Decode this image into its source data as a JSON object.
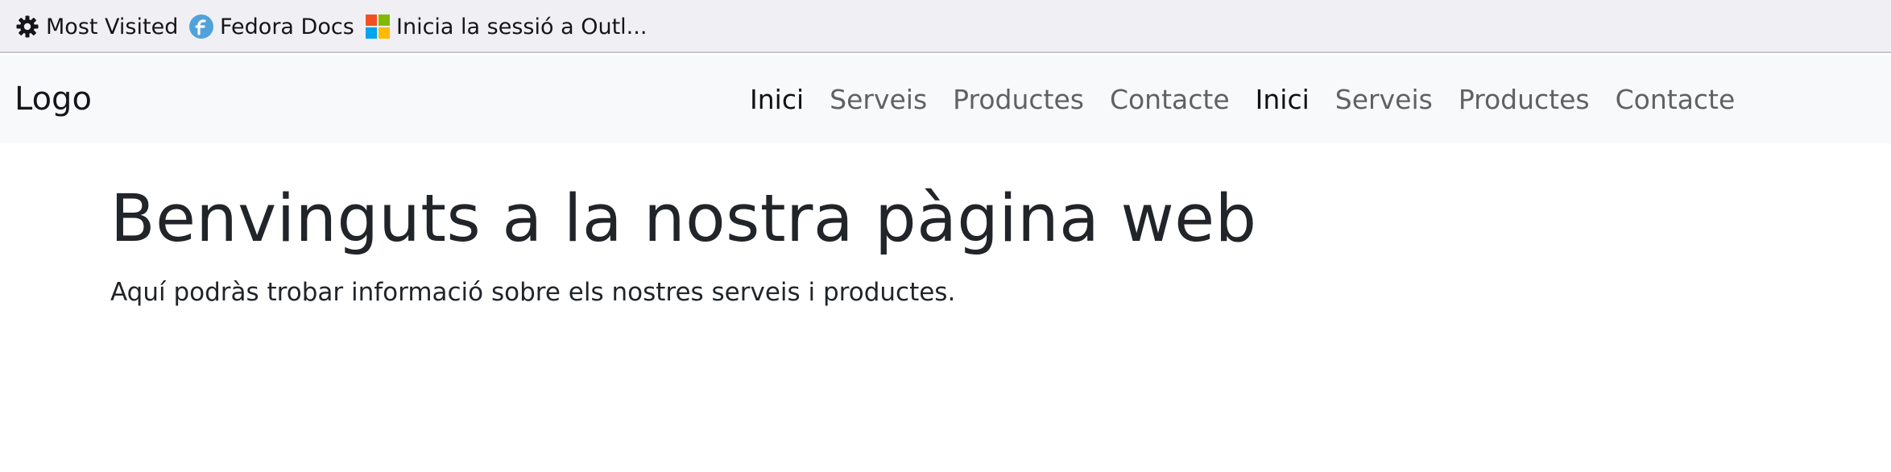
{
  "bookmarks": [
    {
      "label": "Most Visited",
      "icon": "gear-icon"
    },
    {
      "label": "Fedora Docs",
      "icon": "fedora-icon"
    },
    {
      "label": "Inicia la sessió a Outl...",
      "icon": "microsoft-icon"
    }
  ],
  "navbar": {
    "brand": "Logo",
    "links": [
      {
        "label": "Inici",
        "active": true
      },
      {
        "label": "Serveis",
        "active": false
      },
      {
        "label": "Productes",
        "active": false
      },
      {
        "label": "Contacte",
        "active": false
      },
      {
        "label": "Inici",
        "active": true
      },
      {
        "label": "Serveis",
        "active": false
      },
      {
        "label": "Productes",
        "active": false
      },
      {
        "label": "Contacte",
        "active": false
      }
    ]
  },
  "main": {
    "title": "Benvinguts a la nostra pàgina web",
    "text": "Aquí podràs trobar informació sobre els nostres serveis i productes."
  },
  "colors": {
    "toolbar_bg": "#f0f0f4",
    "navbar_bg": "#f8f9fa",
    "text_dark": "#212529",
    "nav_muted": "#616161",
    "fedora_blue": "#51a2da",
    "ms_red": "#f25022",
    "ms_green": "#7fba00",
    "ms_blue": "#00a4ef",
    "ms_yellow": "#ffb900"
  }
}
